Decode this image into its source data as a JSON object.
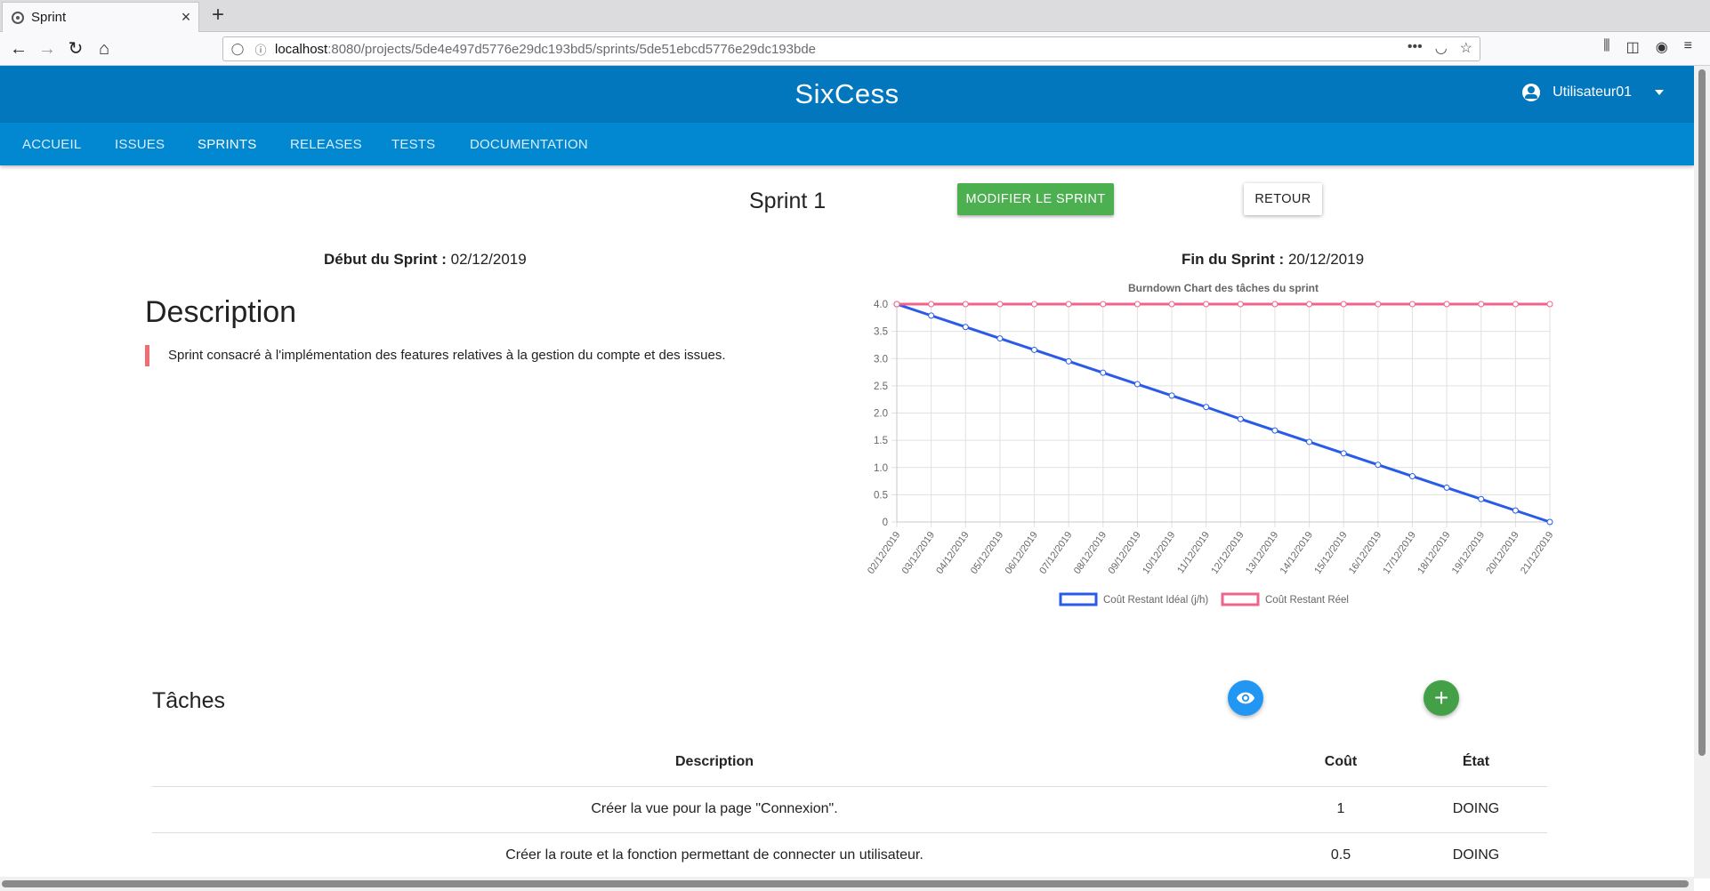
{
  "browser": {
    "tab_title": "Sprint",
    "tab_close": "×",
    "new_tab": "+",
    "url_host": "localhost",
    "url_path": ":8080/projects/5de4e497d5776e29dc193bd5/sprints/5de51ebcd5776e29dc193bde",
    "nav_back": "←",
    "nav_forward": "→",
    "nav_reload": "↻",
    "nav_home": "⌂",
    "url_more": "•••",
    "url_pocket": "◡",
    "url_star": "☆",
    "tool_library": "⫼",
    "tool_sidebar": "◫",
    "tool_account": "◉",
    "tool_menu": "≡"
  },
  "header": {
    "brand": "SixCess",
    "user_name": "Utilisateur01"
  },
  "nav": {
    "items": [
      {
        "label": "ACCUEIL"
      },
      {
        "label": "ISSUES"
      },
      {
        "label": "SPRINTS"
      },
      {
        "label": "RELEASES"
      },
      {
        "label": "TESTS"
      },
      {
        "label": "DOCUMENTATION"
      }
    ]
  },
  "sprint": {
    "title": "Sprint 1",
    "edit_label": "MODIFIER LE SPRINT",
    "back_label": "RETOUR",
    "start_label": "Début du Sprint :",
    "start_date": "02/12/2019",
    "end_label": "Fin du Sprint :",
    "end_date": "20/12/2019",
    "description_heading": "Description",
    "description_text": "Sprint consacré à l'implémentation des features relatives à la gestion du compte et des issues."
  },
  "chart_data": {
    "type": "line",
    "title": "Burndown Chart des tâches du sprint",
    "xlabel": "",
    "ylabel": "",
    "x": [
      "02/12/2019",
      "03/12/2019",
      "04/12/2019",
      "05/12/2019",
      "06/12/2019",
      "07/12/2019",
      "08/12/2019",
      "09/12/2019",
      "10/12/2019",
      "11/12/2019",
      "12/12/2019",
      "13/12/2019",
      "14/12/2019",
      "15/12/2019",
      "16/12/2019",
      "17/12/2019",
      "18/12/2019",
      "19/12/2019",
      "20/12/2019",
      "21/12/2019"
    ],
    "yticks": [
      "0",
      "0.5",
      "1.0",
      "1.5",
      "2.0",
      "2.5",
      "3.0",
      "3.5",
      "4.0"
    ],
    "ylim": [
      0,
      4
    ],
    "grid": true,
    "legend": "bottom",
    "series": [
      {
        "name": "Coût Restant Idéal (j/h)",
        "color": "#2a5be8",
        "values": [
          4.0,
          3.79,
          3.58,
          3.37,
          3.16,
          2.95,
          2.74,
          2.53,
          2.32,
          2.11,
          1.89,
          1.68,
          1.47,
          1.26,
          1.05,
          0.84,
          0.63,
          0.42,
          0.21,
          0.0
        ]
      },
      {
        "name": "Coût Restant Réel",
        "color": "#f0638b",
        "values": [
          4,
          4,
          4,
          4,
          4,
          4,
          4,
          4,
          4,
          4,
          4,
          4,
          4,
          4,
          4,
          4,
          4,
          4,
          4,
          4
        ]
      }
    ]
  },
  "tasks": {
    "heading": "Tâches",
    "add_symbol": "+",
    "columns": {
      "description": "Description",
      "cost": "Coût",
      "state": "État"
    },
    "rows": [
      {
        "description": "Créer la vue pour la page \"Connexion\".",
        "cost": "1",
        "state": "DOING"
      },
      {
        "description": "Créer la route et la fonction permettant de connecter un utilisateur.",
        "cost": "0.5",
        "state": "DOING"
      }
    ]
  },
  "colors": {
    "header": "#0277bd",
    "nav": "#0288d1",
    "edit_button": "#4caf50",
    "view_fab": "#2196f3",
    "add_fab": "#43a047",
    "quote_border": "#ee6e73"
  }
}
